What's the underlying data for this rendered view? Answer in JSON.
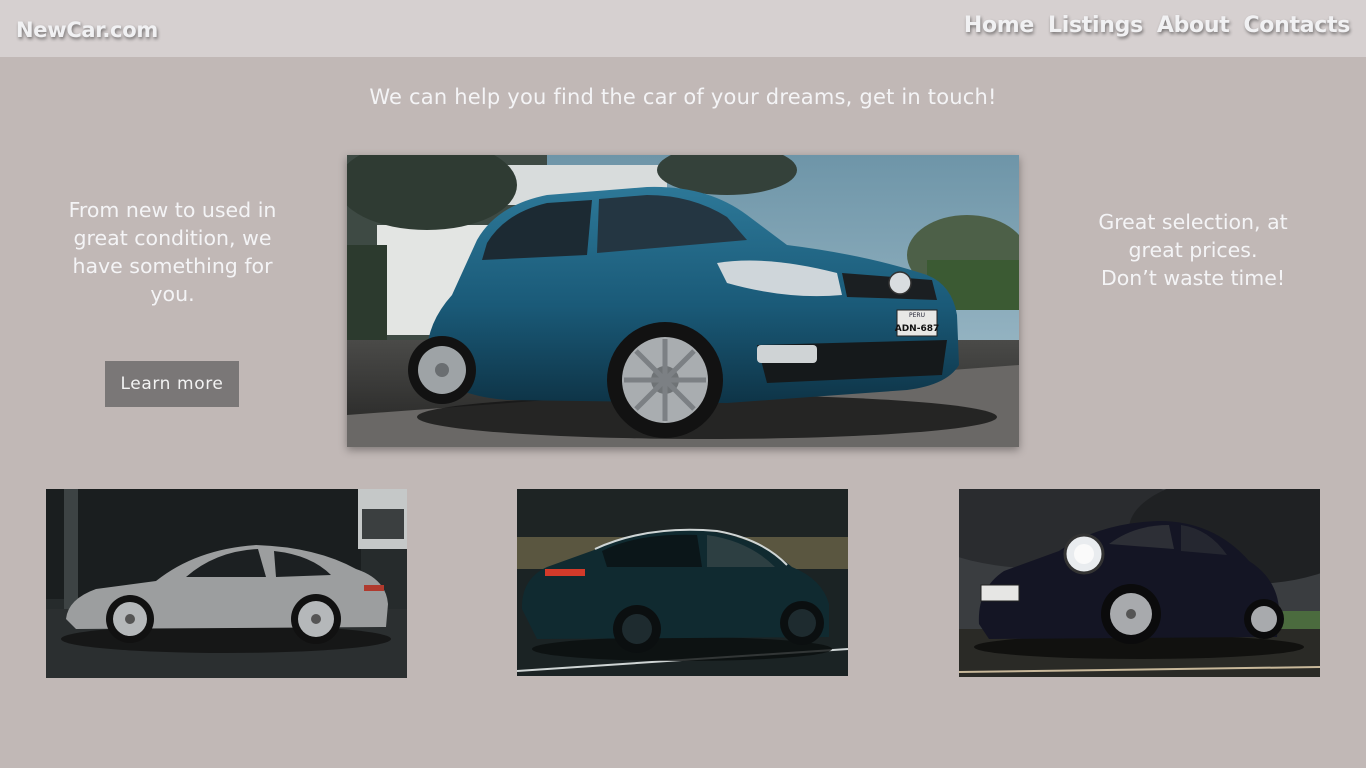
{
  "header": {
    "brand": "NewCar.com",
    "nav": [
      "Home",
      "Listings",
      "About",
      "Contacts"
    ]
  },
  "main": {
    "tagline": "We can help you find the car of your dreams, get in touch!",
    "left_text": "From new to used in great condition, we have something for you.",
    "right_text_line1": "Great selection, at great prices.",
    "right_text_line2": "Don’t waste time!",
    "button_label": "Learn more",
    "hero_plate": "ADN-687",
    "hero_plate_top": "PERU"
  },
  "colors": {
    "background": "#c1b8b6",
    "navbar": "#d6d0d0",
    "button": "#7a7777",
    "text": "#f4f4f6"
  }
}
